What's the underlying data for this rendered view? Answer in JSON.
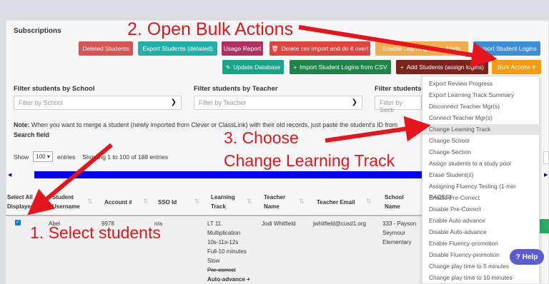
{
  "section_title": "Subscriptions",
  "buttons_row1": [
    {
      "label": "Deleted Students",
      "color": "#d9534f"
    },
    {
      "label": "Export Students (detailed)",
      "color": "#20b2aa"
    },
    {
      "label": "Usage Report",
      "color": "#b03060"
    },
    {
      "label": "Delete csv import and do it over!",
      "color": "#e0443c",
      "icon": "🗑"
    },
    {
      "label": "Enable Learning Track Alerts",
      "color": "#f0ad4e"
    },
    {
      "label": "Export Student Logins",
      "color": "#3b8fd9"
    }
  ],
  "buttons_row2": [
    {
      "label": "Update Database",
      "color": "#17a589",
      "icon": "✎"
    },
    {
      "label": "Import Student Logins from CSV",
      "color": "#1e8449",
      "icon": "+"
    },
    {
      "label": "Add Students (assign logins)",
      "color": "#7b241c",
      "icon": "+"
    },
    {
      "label": "Bulk Actions ▾",
      "color": "#f39c12"
    }
  ],
  "filters": [
    {
      "label": "Filter students by School",
      "placeholder": "Filter by School"
    },
    {
      "label": "Filter students by Teacher",
      "placeholder": "Filter by Teacher"
    },
    {
      "label": "Filter students",
      "placeholder": "Filter by Secti"
    }
  ],
  "note": {
    "bold": "Note:",
    "text": " When you want to merge a student (newly imported from Clever or ClassLink) with their old records, just paste the student's ID from",
    "line2": "Search field"
  },
  "table_controls": {
    "show": "Show",
    "length": "100",
    "entries": "entries",
    "info": "Showing 1 to 100 of 188 entries"
  },
  "columns": {
    "select_all": "Select All Displayed",
    "student_username": "Student Username",
    "account": "Account #",
    "sso": "SSO Id",
    "learning_track": "Learning Track",
    "teacher_name": "Teacher Name",
    "teacher_email": "Teacher Email",
    "school_name": "School Name"
  },
  "row": {
    "username": "Abel",
    "account": "9978",
    "sso": "n/a",
    "track_line1": "LT 11.",
    "track_line2": "Multiplication",
    "track_line3": "10s-11s-12s",
    "track_line4": "Full-10 minutes",
    "track_line5": "Slow",
    "track_line6": "Pre-correct",
    "track_line7": "Auto-advance +",
    "teacher_name": "Jodi Whitfield",
    "teacher_email": "jwhitfield@cusd1.org",
    "school_line1": "333 - Payson",
    "school_line2": "Seymour",
    "school_line3": "Elementary"
  },
  "bulk_menu": [
    "Export Review Progress",
    "Export Learning Track Summary",
    "Disconnect Teacher Mgr(s)",
    "Connect Teacher Mgr(s)",
    "Change Learning Track",
    "Change School",
    "Change Section",
    "Assign students to a study pool",
    "Erase Student(s)",
    "Assigning Fluency Testing (1-min RACES)",
    "Enable Pre-Correct",
    "Disable Pre-Correct",
    "Enable Auto-advance",
    "Disable Auto-advance",
    "Enable Fluency-promotion",
    "Disable Fluency-promotion",
    "Change play time to 5 minutes",
    "Change play time to 10 minutes"
  ],
  "help_label": "Help",
  "annotations": {
    "step2": "2. Open Bulk Actions",
    "step3_line1": "3. Choose",
    "step3_line2": "Change Learning Track",
    "step1": "1. Select students"
  },
  "annotation_color": "#e8141b"
}
